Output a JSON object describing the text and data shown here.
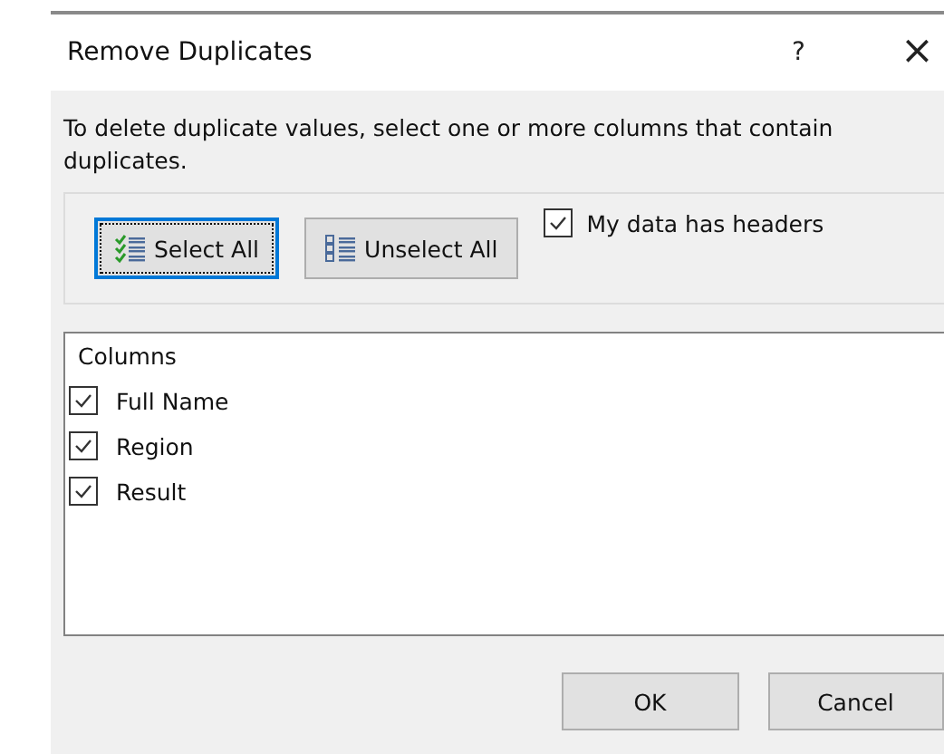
{
  "window": {
    "title": "Remove Duplicates",
    "help": "?",
    "close": "×"
  },
  "instructions": "To delete duplicate values, select one or more columns that contain duplicates.",
  "toolbar": {
    "buttons": [
      {
        "kind": "select",
        "label": "Select All",
        "focused": true
      },
      {
        "kind": "unselect",
        "label": "Unselect All",
        "focused": false
      }
    ],
    "headers_checkbox": {
      "label": "My data has headers",
      "checked": true
    }
  },
  "columns_list": {
    "heading": "Columns",
    "items": [
      {
        "label": "Full Name",
        "checked": true
      },
      {
        "label": "Region",
        "checked": true
      },
      {
        "label": "Result",
        "checked": true
      }
    ]
  },
  "buttons": [
    "OK",
    "Cancel"
  ]
}
